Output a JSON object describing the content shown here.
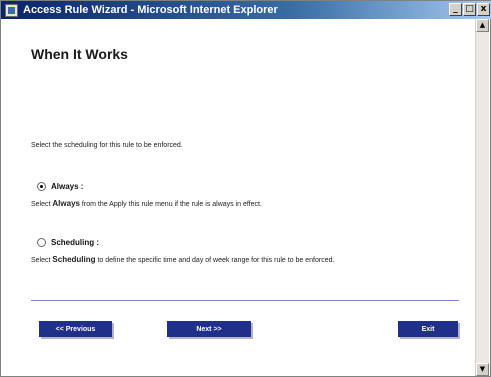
{
  "window": {
    "title": "Access Rule Wizard - Microsoft Internet Explorer",
    "controls": {
      "minimize": "_",
      "maximize": "□",
      "close": "x"
    }
  },
  "page": {
    "title": "When It Works",
    "intro": "Select the scheduling for this rule to be enforced."
  },
  "options": {
    "always": {
      "label": "Always :",
      "selected": true,
      "desc_bold": "Always",
      "desc_prefix": "Select ",
      "desc_rest": " from the Apply this rule menu if the rule is always in effect."
    },
    "scheduling": {
      "label": "Scheduling :",
      "selected": false,
      "desc_bold": "Scheduling",
      "desc_prefix": "Select ",
      "desc_rest": " to define the specific time and day of week range for this rule to be enforced."
    }
  },
  "buttons": {
    "previous": "<< Previous",
    "next": "Next >>",
    "exit": "Exit"
  },
  "colors": {
    "button_bg": "#1f2f8a",
    "divider": "#7b88c4",
    "titlebar_start": "#0a246a"
  },
  "scrollbar": {
    "up_glyph": "▲",
    "down_glyph": "▼"
  }
}
